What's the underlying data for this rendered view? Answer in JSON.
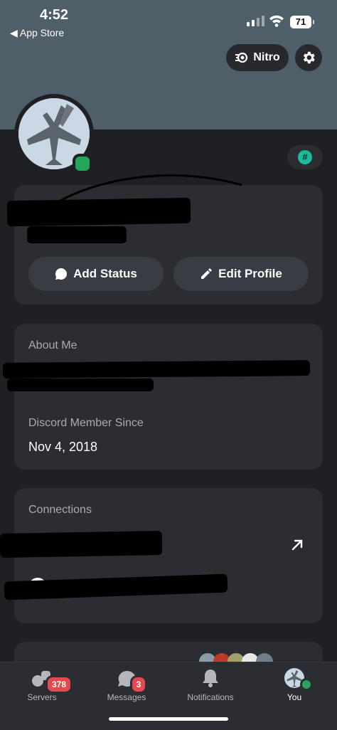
{
  "status_bar": {
    "time": "4:52",
    "back_label": "◀ App Store",
    "battery": "71"
  },
  "header": {
    "nitro_label": "Nitro"
  },
  "profile": {
    "buttons": {
      "add_status": "Add Status",
      "edit_profile": "Edit Profile"
    }
  },
  "about": {
    "label": "About Me",
    "member_since_label": "Discord Member Since",
    "member_since_value": "Nov 4, 2018"
  },
  "connections": {
    "label": "Connections"
  },
  "tabs": {
    "servers": {
      "label": "Servers",
      "badge": "378"
    },
    "messages": {
      "label": "Messages",
      "badge": "3"
    },
    "notifications": {
      "label": "Notifications"
    },
    "you": {
      "label": "You"
    }
  },
  "colors": {
    "accent_online": "#23a55a",
    "badge_red": "#e5484d",
    "teal": "#1abc9c"
  }
}
